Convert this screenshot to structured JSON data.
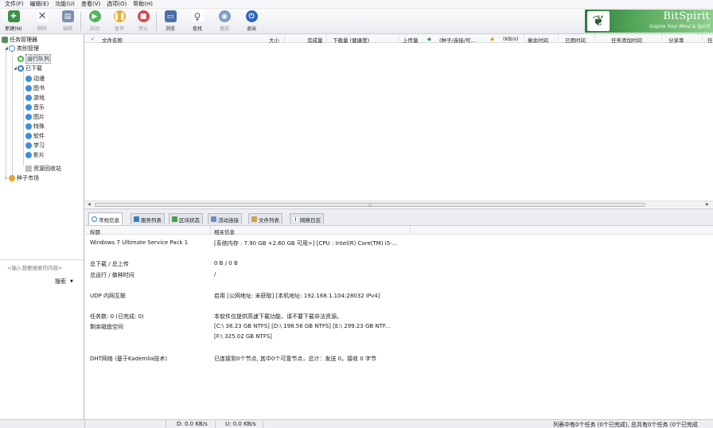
{
  "menubar": [
    "文件(F)",
    "编辑(E)",
    "功能(U)",
    "查看(V)",
    "选项(O)",
    "帮助(H)"
  ],
  "toolbar": {
    "new": "新建(N)",
    "delete": "删除",
    "edit": "编辑",
    "start": "启动",
    "pause": "暂停",
    "stop": "停止",
    "browse": "浏览",
    "find": "查找",
    "play": "播放",
    "exit": "退出"
  },
  "logo": {
    "brand": "BitSpirit",
    "slogan": "Inspire Your Mind & Spirit"
  },
  "tree": {
    "task_manager": "任务管理器",
    "category_manager": "类别管理",
    "running_queue": "运行队列",
    "downloaded": "已下载",
    "animation": "动漫",
    "books": "图书",
    "games": "游戏",
    "music": "音乐",
    "pictures": "图片",
    "specials": "特殊",
    "software": "软件",
    "study": "学习",
    "movies": "影片",
    "recycle_bin": "资源回收站",
    "seed_market": "种子市场"
  },
  "search": {
    "placeholder": "<输入想要搜索的内容>",
    "button": "搜索"
  },
  "columns": {
    "file_name": "文件名称",
    "size": "大小",
    "completed": "完成量",
    "download_amount": "下载量 (健康度)",
    "upload_amount": "上传量",
    "seeds": "(种子/连接/可...",
    "speed": "(KB/s)",
    "remaining": "剩余时间",
    "used_time": "已用时间",
    "added_time": "任务添加时间",
    "share_rate": "分享率",
    "overflow": "任"
  },
  "tabs": [
    "常规信息",
    "服务列表",
    "区块状态",
    "活动连接",
    "文件列表",
    "网络日志"
  ],
  "detail": {
    "header_title": "标题",
    "header_info": "相关信息",
    "rows": {
      "os_label": "Windows 7 Ultimate Service Pack 1",
      "os_value": "[系统内存 : 7.90 GB +2.60 GB 可用>] [CPU : Intel(R) Core(TM) i5-...",
      "total_label": "总下载 / 总上传",
      "total_value": "0 B / 0 B",
      "runtime_label": "总运行 / 做种时间",
      "runtime_value": "/",
      "udp_label": "UDP 内网互联",
      "udp_value": "启用 [公网地址: 未获取] [本机地址: 192.168.1.104:28032 IPv4]",
      "tasks_label": "任务数: 0 (已完成: 0)",
      "disk_label": "剩余磁盘空间",
      "tasks_value": "本软件仅提供高速下载功能，请不要下载非法资源。",
      "disk_value_1": "[C:\\ 38.23 GB  NTFS]  [D:\\ 198.56 GB  NTFS]  [E:\\ 299.23 GB  NTF...",
      "disk_value_2": "[F:\\ 325.02 GB  NTFS]",
      "dht_label": "DHT网络 (基于Kademlia技术)",
      "dht_value": "已连接到0个节点, 其中0个可靠节点，总计：发送 0，接收 0 字节"
    }
  },
  "status": {
    "down": "D: 0.0 KB/s",
    "up": "U: 0.0 KB/s",
    "summary": "列表中有0个任务 (0个已完成), 总共有0个任务 (0个已完成"
  }
}
